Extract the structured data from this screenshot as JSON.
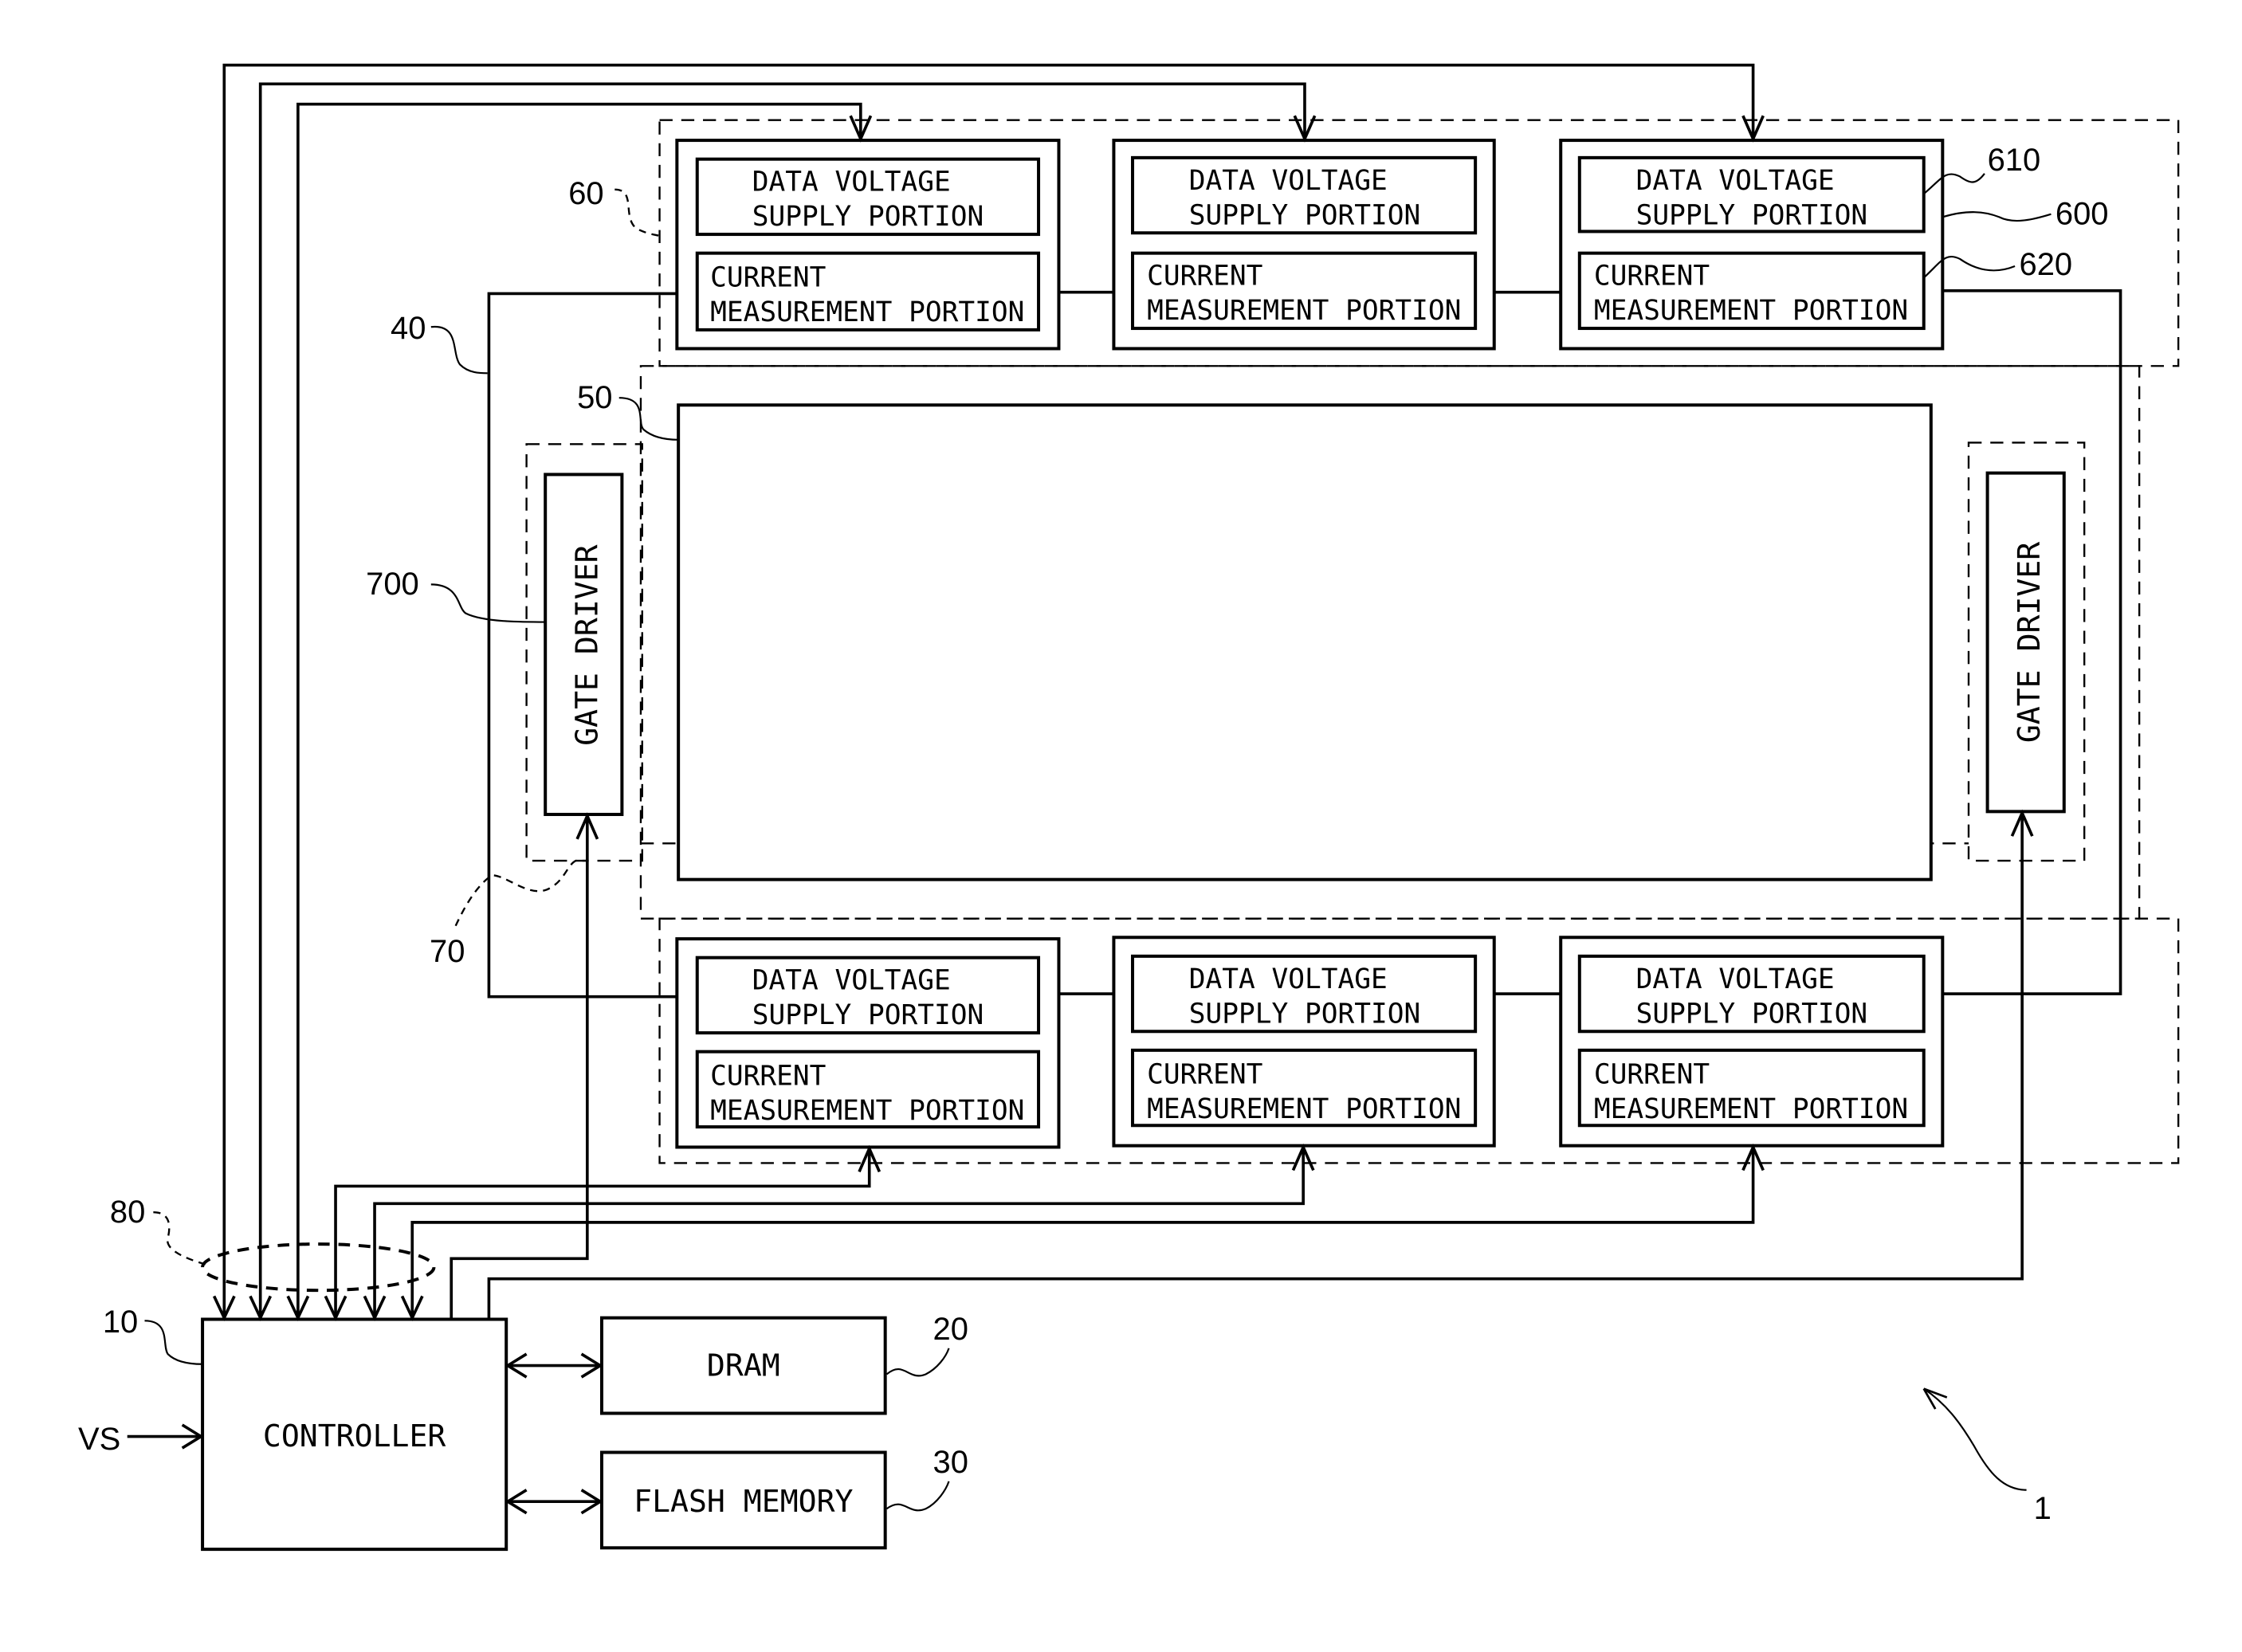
{
  "figure": {
    "reference_numeral": "1",
    "input_signal": "VS"
  },
  "controller": {
    "label": "CONTROLLER",
    "ref": "10"
  },
  "dram": {
    "label": "DRAM",
    "ref": "20"
  },
  "flash": {
    "label": "FLASH MEMORY",
    "ref": "30"
  },
  "display_panel": {
    "ref": "50"
  },
  "power_line": {
    "ref": "40"
  },
  "source_group": {
    "ref": "60"
  },
  "gate_group": {
    "ref": "70"
  },
  "signal_bus": {
    "ref": "80"
  },
  "source_module": {
    "ref": "600",
    "dvs_ref": "610",
    "cm_ref": "620",
    "dvs_line1": "DATA VOLTAGE",
    "dvs_line2": "SUPPLY PORTION",
    "cm_line1": "CURRENT",
    "cm_line2": "MEASUREMENT PORTION"
  },
  "gate_driver": {
    "label": "GATE DRIVER",
    "ref": "700"
  }
}
